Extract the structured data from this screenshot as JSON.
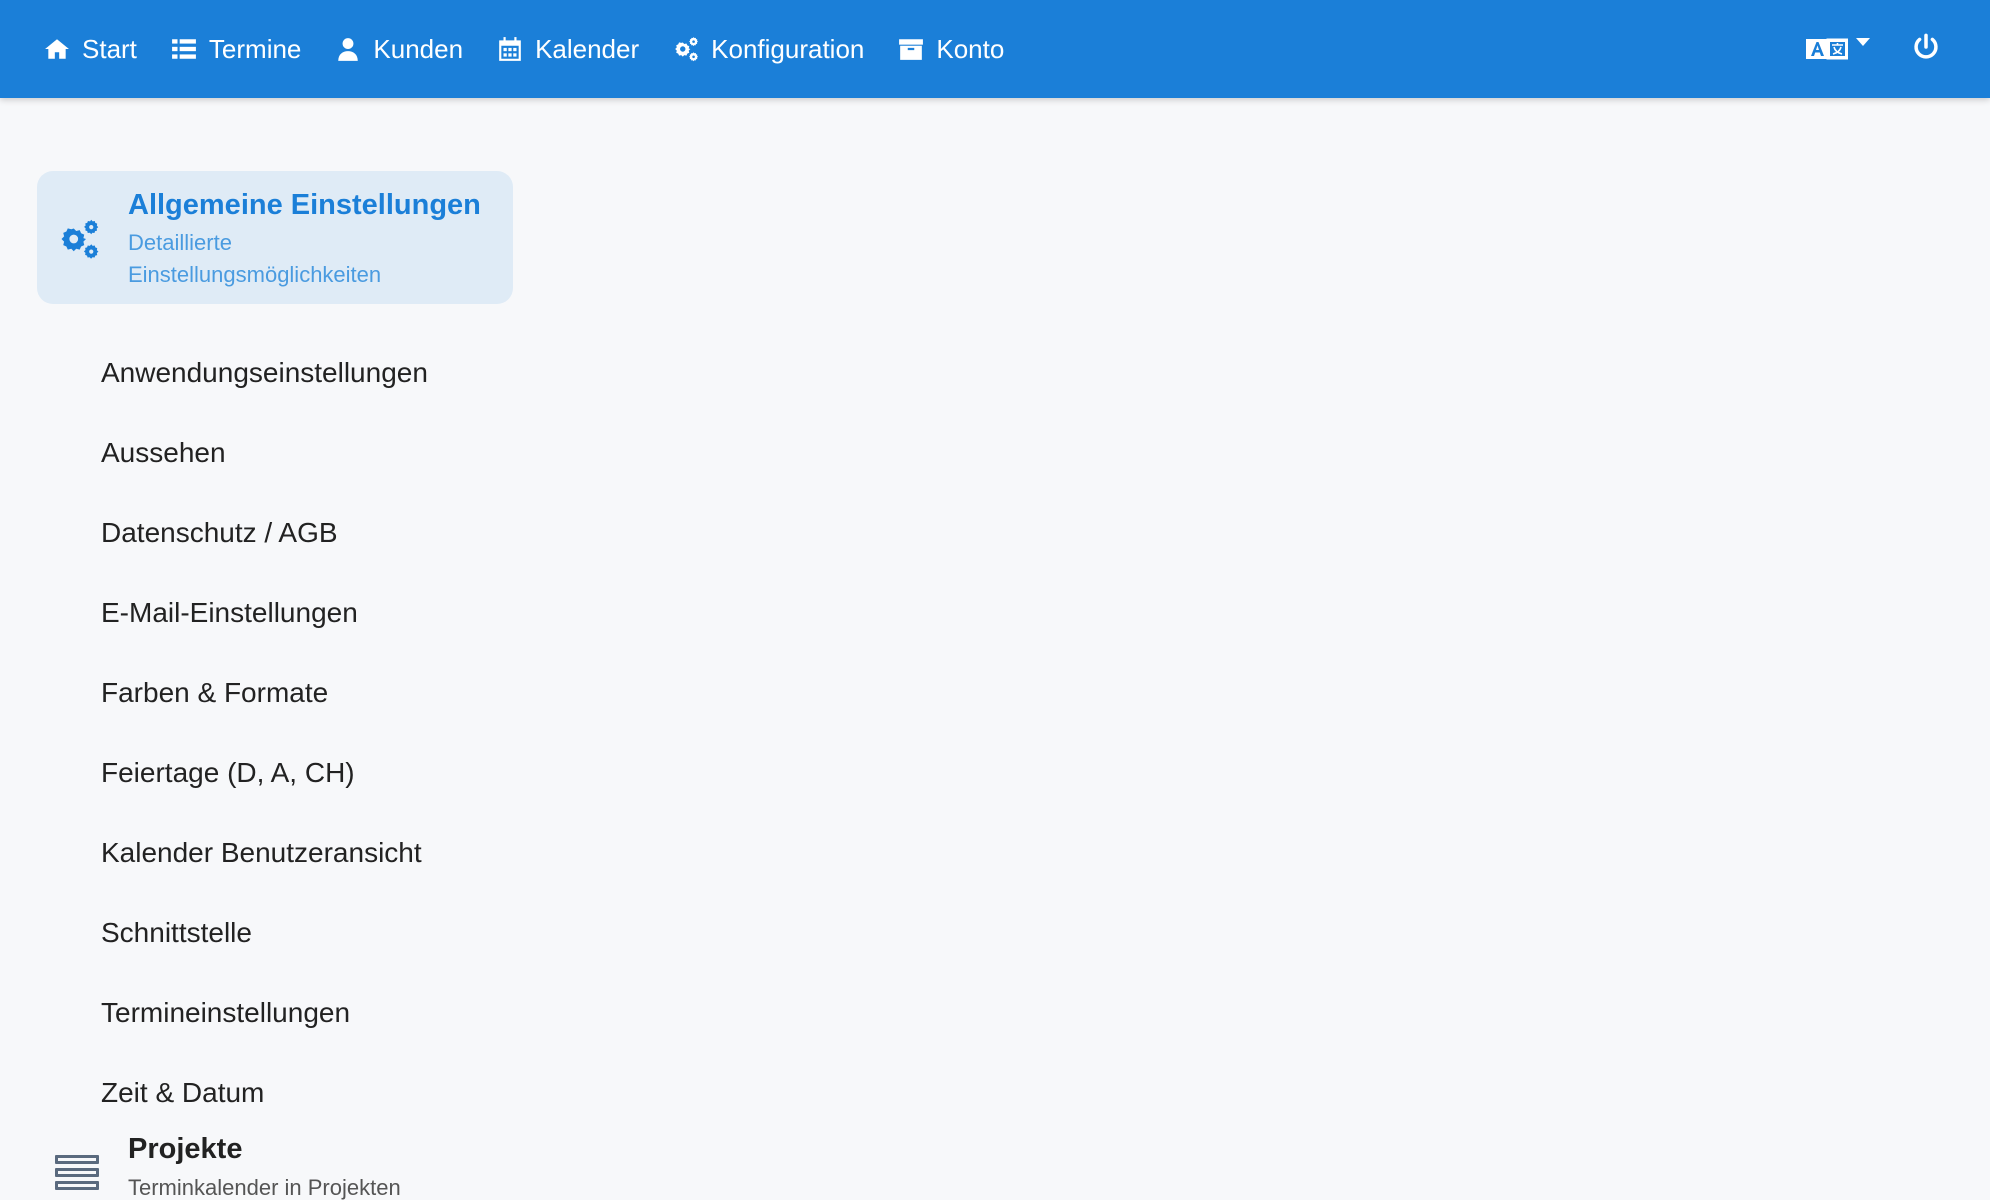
{
  "nav": {
    "items": [
      {
        "label": "Start",
        "icon": "home-icon"
      },
      {
        "label": "Termine",
        "icon": "list-icon"
      },
      {
        "label": "Kunden",
        "icon": "user-icon"
      },
      {
        "label": "Kalender",
        "icon": "calendar-icon"
      },
      {
        "label": "Konfiguration",
        "icon": "gears-icon"
      },
      {
        "label": "Konto",
        "icon": "archive-icon"
      }
    ],
    "language_icon": "translate-icon",
    "power_icon": "power-icon"
  },
  "sidebar": {
    "active_section": {
      "title": "Allgemeine Einstellungen",
      "subtitle": "Detaillierte Einstellungsmöglichkeiten",
      "icon": "gears-icon"
    },
    "items": [
      "Anwendungseinstellungen",
      "Aussehen",
      "Datenschutz / AGB",
      "E-Mail-Einstellungen",
      "Farben & Formate",
      "Feiertage (D, A, CH)",
      "Kalender Benutzeransicht",
      "Schnittstelle",
      "Termineinstellungen",
      "Zeit & Datum"
    ],
    "next_section": {
      "title": "Projekte",
      "subtitle": "Terminkalender in Projekten",
      "icon": "server-stack-icon"
    }
  },
  "colors": {
    "topbar": "#1b7fd8",
    "active_bg": "#dfebf6",
    "active_text": "#1b7fd8",
    "page_bg": "#f7f8fa"
  }
}
